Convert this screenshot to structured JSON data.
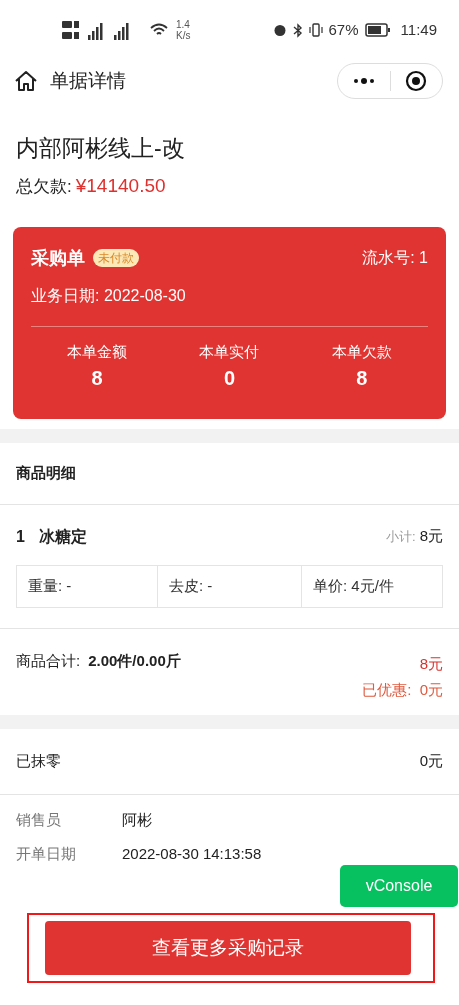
{
  "status_bar": {
    "network_speed": "1.4",
    "network_unit": "K/s",
    "battery": "67%",
    "time": "11:49"
  },
  "nav": {
    "title": "单据详情"
  },
  "header": {
    "name": "内部阿彬线上-改",
    "debt_label": "总欠款:",
    "debt_value": "¥14140.50"
  },
  "card": {
    "type": "采购单",
    "badge": "未付款",
    "serial": "流水号: 1",
    "date": "业务日期: 2022-08-30",
    "stats": [
      {
        "label": "本单金额",
        "value": "8"
      },
      {
        "label": "本单实付",
        "value": "0"
      },
      {
        "label": "本单欠款",
        "value": "8"
      }
    ]
  },
  "goods": {
    "title": "商品明细",
    "items": [
      {
        "index": "1",
        "name": "冰糖定",
        "subtotal_label": "小计:",
        "subtotal": "8元",
        "cells": [
          "重量: -",
          "去皮: -",
          "单价: 4元/件"
        ]
      }
    ],
    "total_label": "商品合计:",
    "total_value": "2.00件/0.00斤",
    "amount": "8元",
    "discount": "已优惠:  0元"
  },
  "rounding": {
    "label": "已抹零",
    "value": "0元"
  },
  "info": [
    {
      "label": "销售员",
      "value": "阿彬"
    },
    {
      "label": "开单日期",
      "value": "2022-08-30 14:13:58"
    }
  ],
  "vconsole": "vConsole",
  "button": "查看更多采购记录"
}
